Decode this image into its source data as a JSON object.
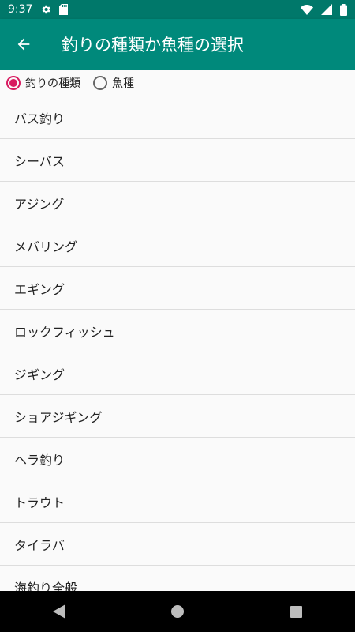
{
  "statusbar": {
    "time": "9:37",
    "left_icons": [
      "gear-icon",
      "sdcard-icon"
    ],
    "right_icons": [
      "wifi-icon",
      "signal-icon",
      "battery-icon"
    ]
  },
  "appbar": {
    "back_icon": "back-arrow-icon",
    "title": "釣りの種類か魚種の選択",
    "color": "#00897b"
  },
  "radio_group": {
    "options": [
      {
        "label": "釣りの種類",
        "checked": true
      },
      {
        "label": "魚種",
        "checked": false
      }
    ],
    "accent_color": "#d81b60"
  },
  "list": {
    "items": [
      "バス釣り",
      "シーバス",
      "アジング",
      "メバリング",
      "エギング",
      "ロックフィッシュ",
      "ジギング",
      "ショアジギング",
      "ヘラ釣り",
      "トラウト",
      "タイラバ",
      "海釣り全般"
    ]
  },
  "navbar": {
    "buttons": [
      "back-triangle-icon",
      "home-circle-icon",
      "recents-square-icon"
    ]
  }
}
